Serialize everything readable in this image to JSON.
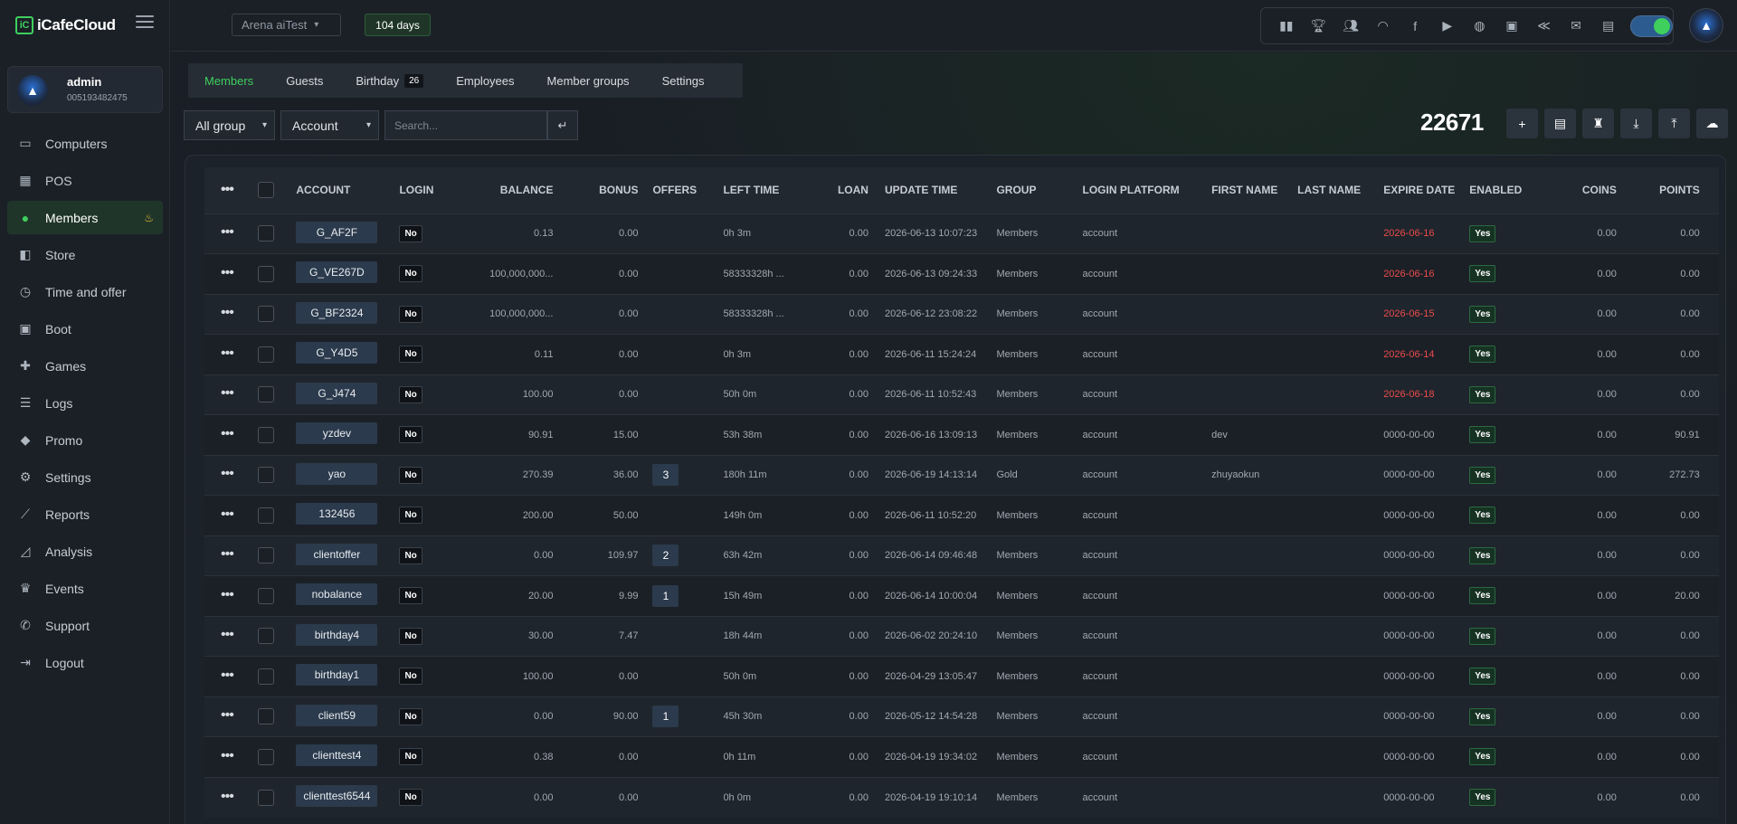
{
  "app": {
    "logo": "iCafeCloud"
  },
  "user": {
    "name": "admin",
    "id": "005193482475"
  },
  "nav": [
    {
      "label": "Computers",
      "icon": "monitor-icon"
    },
    {
      "label": "POS",
      "icon": "cash-register-icon"
    },
    {
      "label": "Members",
      "icon": "members-icon",
      "active": true
    },
    {
      "label": "Store",
      "icon": "store-bag-icon"
    },
    {
      "label": "Time and offer",
      "icon": "clock-icon"
    },
    {
      "label": "Boot",
      "icon": "windows-icon"
    },
    {
      "label": "Games",
      "icon": "gamepad-icon"
    },
    {
      "label": "Logs",
      "icon": "list-icon"
    },
    {
      "label": "Promo",
      "icon": "tag-icon"
    },
    {
      "label": "Settings",
      "icon": "gear-icon"
    },
    {
      "label": "Reports",
      "icon": "line-chart-icon"
    },
    {
      "label": "Analysis",
      "icon": "area-chart-icon"
    },
    {
      "label": "Events",
      "icon": "crown-icon"
    },
    {
      "label": "Support",
      "icon": "phone-icon"
    },
    {
      "label": "Logout",
      "icon": "logout-icon"
    }
  ],
  "topbar": {
    "branch": "Arena aiTest",
    "days": "104 days"
  },
  "tabs": [
    {
      "label": "Members",
      "active": true
    },
    {
      "label": "Guests"
    },
    {
      "label": "Birthday",
      "count": "26"
    },
    {
      "label": "Employees"
    },
    {
      "label": "Member groups"
    },
    {
      "label": "Settings"
    }
  ],
  "filters": {
    "group": "All group",
    "field": "Account",
    "search_placeholder": "Search..."
  },
  "member_count": "22671",
  "table": {
    "headers": [
      "Account",
      "Login",
      "Balance",
      "Bonus",
      "Offers",
      "Left time",
      "Loan",
      "Update time",
      "Group",
      "Login platform",
      "First name",
      "Last name",
      "Expire date",
      "Enabled",
      "Coins",
      "Points"
    ],
    "rows": [
      {
        "account": "G_AF2F",
        "login": "No",
        "balance": "0.13",
        "bonus": "0.00",
        "offers": "",
        "left": "0h 3m",
        "loan": "0.00",
        "update": "2026-06-13 10:07:23",
        "group": "Members",
        "platform": "account",
        "first": "",
        "last": "",
        "expire": "2026-06-16",
        "expired": true,
        "enabled": "Yes",
        "coins": "0.00",
        "points": "0.00"
      },
      {
        "account": "G_VE267D",
        "login": "No",
        "balance": "100,000,000...",
        "bonus": "0.00",
        "offers": "",
        "left": "58333328h ...",
        "loan": "0.00",
        "update": "2026-06-13 09:24:33",
        "group": "Members",
        "platform": "account",
        "first": "",
        "last": "",
        "expire": "2026-06-16",
        "expired": true,
        "enabled": "Yes",
        "coins": "0.00",
        "points": "0.00"
      },
      {
        "account": "G_BF2324",
        "login": "No",
        "balance": "100,000,000...",
        "bonus": "0.00",
        "offers": "",
        "left": "58333328h ...",
        "loan": "0.00",
        "update": "2026-06-12 23:08:22",
        "group": "Members",
        "platform": "account",
        "first": "",
        "last": "",
        "expire": "2026-06-15",
        "expired": true,
        "enabled": "Yes",
        "coins": "0.00",
        "points": "0.00"
      },
      {
        "account": "G_Y4D5",
        "login": "No",
        "balance": "0.11",
        "bonus": "0.00",
        "offers": "",
        "left": "0h 3m",
        "loan": "0.00",
        "update": "2026-06-11 15:24:24",
        "group": "Members",
        "platform": "account",
        "first": "",
        "last": "",
        "expire": "2026-06-14",
        "expired": true,
        "enabled": "Yes",
        "coins": "0.00",
        "points": "0.00"
      },
      {
        "account": "G_J474",
        "login": "No",
        "balance": "100.00",
        "bonus": "0.00",
        "offers": "",
        "left": "50h 0m",
        "loan": "0.00",
        "update": "2026-06-11 10:52:43",
        "group": "Members",
        "platform": "account",
        "first": "",
        "last": "",
        "expire": "2026-06-18",
        "expired": true,
        "enabled": "Yes",
        "coins": "0.00",
        "points": "0.00"
      },
      {
        "account": "yzdev",
        "login": "No",
        "balance": "90.91",
        "bonus": "15.00",
        "offers": "",
        "left": "53h 38m",
        "loan": "0.00",
        "update": "2026-06-16 13:09:13",
        "group": "Members",
        "platform": "account",
        "first": "dev",
        "last": "",
        "expire": "0000-00-00",
        "expired": false,
        "enabled": "Yes",
        "coins": "0.00",
        "points": "90.91"
      },
      {
        "account": "yao",
        "login": "No",
        "balance": "270.39",
        "bonus": "36.00",
        "offers": "3",
        "left": "180h 11m",
        "loan": "0.00",
        "update": "2026-06-19 14:13:14",
        "group": "Gold",
        "platform": "account",
        "first": "zhuyaokun",
        "last": "",
        "expire": "0000-00-00",
        "expired": false,
        "enabled": "Yes",
        "coins": "0.00",
        "points": "272.73"
      },
      {
        "account": "132456",
        "login": "No",
        "balance": "200.00",
        "bonus": "50.00",
        "offers": "",
        "left": "149h 0m",
        "loan": "0.00",
        "update": "2026-06-11 10:52:20",
        "group": "Members",
        "platform": "account",
        "first": "",
        "last": "",
        "expire": "0000-00-00",
        "expired": false,
        "enabled": "Yes",
        "coins": "0.00",
        "points": "0.00"
      },
      {
        "account": "clientoffer",
        "login": "No",
        "balance": "0.00",
        "bonus": "109.97",
        "offers": "2",
        "left": "63h 42m",
        "loan": "0.00",
        "update": "2026-06-14 09:46:48",
        "group": "Members",
        "platform": "account",
        "first": "",
        "last": "",
        "expire": "0000-00-00",
        "expired": false,
        "enabled": "Yes",
        "coins": "0.00",
        "points": "0.00"
      },
      {
        "account": "nobalance",
        "login": "No",
        "balance": "20.00",
        "bonus": "9.99",
        "offers": "1",
        "left": "15h 49m",
        "loan": "0.00",
        "update": "2026-06-14 10:00:04",
        "group": "Members",
        "platform": "account",
        "first": "",
        "last": "",
        "expire": "0000-00-00",
        "expired": false,
        "enabled": "Yes",
        "coins": "0.00",
        "points": "20.00"
      },
      {
        "account": "birthday4",
        "login": "No",
        "balance": "30.00",
        "bonus": "7.47",
        "offers": "",
        "left": "18h 44m",
        "loan": "0.00",
        "update": "2026-06-02 20:24:10",
        "group": "Members",
        "platform": "account",
        "first": "",
        "last": "",
        "expire": "0000-00-00",
        "expired": false,
        "enabled": "Yes",
        "coins": "0.00",
        "points": "0.00"
      },
      {
        "account": "birthday1",
        "login": "No",
        "balance": "100.00",
        "bonus": "0.00",
        "offers": "",
        "left": "50h 0m",
        "loan": "0.00",
        "update": "2026-04-29 13:05:47",
        "group": "Members",
        "platform": "account",
        "first": "",
        "last": "",
        "expire": "0000-00-00",
        "expired": false,
        "enabled": "Yes",
        "coins": "0.00",
        "points": "0.00"
      },
      {
        "account": "client59",
        "login": "No",
        "balance": "0.00",
        "bonus": "90.00",
        "offers": "1",
        "left": "45h 30m",
        "loan": "0.00",
        "update": "2026-05-12 14:54:28",
        "group": "Members",
        "platform": "account",
        "first": "",
        "last": "",
        "expire": "0000-00-00",
        "expired": false,
        "enabled": "Yes",
        "coins": "0.00",
        "points": "0.00"
      },
      {
        "account": "clienttest4",
        "login": "No",
        "balance": "0.38",
        "bonus": "0.00",
        "offers": "",
        "left": "0h 11m",
        "loan": "0.00",
        "update": "2026-04-19 19:34:02",
        "group": "Members",
        "platform": "account",
        "first": "",
        "last": "",
        "expire": "0000-00-00",
        "expired": false,
        "enabled": "Yes",
        "coins": "0.00",
        "points": "0.00"
      },
      {
        "account": "clienttest6544",
        "login": "No",
        "balance": "0.00",
        "bonus": "0.00",
        "offers": "",
        "left": "0h 0m",
        "loan": "0.00",
        "update": "2026-04-19 19:10:14",
        "group": "Members",
        "platform": "account",
        "first": "",
        "last": "",
        "expire": "0000-00-00",
        "expired": false,
        "enabled": "Yes",
        "coins": "0.00",
        "points": "0.00"
      }
    ]
  },
  "colors": {
    "accent": "#3ecf5d",
    "expired": "#ec4b4b",
    "background": "#1a1f26"
  }
}
